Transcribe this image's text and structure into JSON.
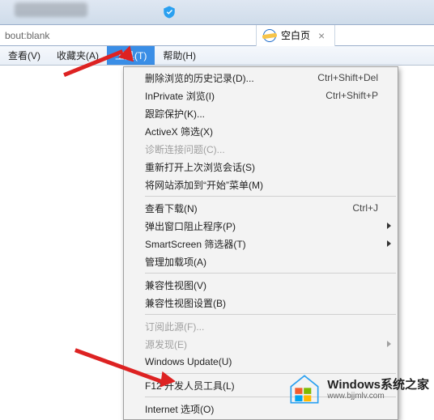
{
  "titlebar": {},
  "address": {
    "url": "bout:blank"
  },
  "tab": {
    "title": "空白页",
    "icon": "ie-icon"
  },
  "menubar": {
    "items": [
      {
        "label": "查看(V)"
      },
      {
        "label": "收藏夹(A)"
      },
      {
        "label": "工具(T)"
      },
      {
        "label": "帮助(H)"
      }
    ],
    "active_index": 2
  },
  "tools_menu": {
    "items": [
      {
        "label": "删除浏览的历史记录(D)...",
        "shortcut": "Ctrl+Shift+Del"
      },
      {
        "label": "InPrivate 浏览(I)",
        "shortcut": "Ctrl+Shift+P"
      },
      {
        "label": "跟踪保护(K)..."
      },
      {
        "label": "ActiveX 筛选(X)"
      },
      {
        "label": "诊断连接问题(C)...",
        "disabled": true
      },
      {
        "label": "重新打开上次浏览会话(S)"
      },
      {
        "label": "将网站添加到“开始”菜单(M)"
      },
      {
        "sep": true
      },
      {
        "label": "查看下载(N)",
        "shortcut": "Ctrl+J"
      },
      {
        "label": "弹出窗口阻止程序(P)",
        "submenu": true
      },
      {
        "label": "SmartScreen 筛选器(T)",
        "submenu": true
      },
      {
        "label": "管理加载项(A)"
      },
      {
        "sep": true
      },
      {
        "label": "兼容性视图(V)"
      },
      {
        "label": "兼容性视图设置(B)"
      },
      {
        "sep": true
      },
      {
        "label": "订阅此源(F)...",
        "disabled": true
      },
      {
        "label": "源发现(E)",
        "disabled": true,
        "submenu": true
      },
      {
        "label": "Windows Update(U)"
      },
      {
        "sep": true
      },
      {
        "label": "F12 开发人员工具(L)"
      },
      {
        "sep": true
      },
      {
        "label": "Internet 选项(O)"
      }
    ]
  },
  "watermark": {
    "title": "Windows系统之家",
    "url": "www.bjjmlv.com"
  }
}
